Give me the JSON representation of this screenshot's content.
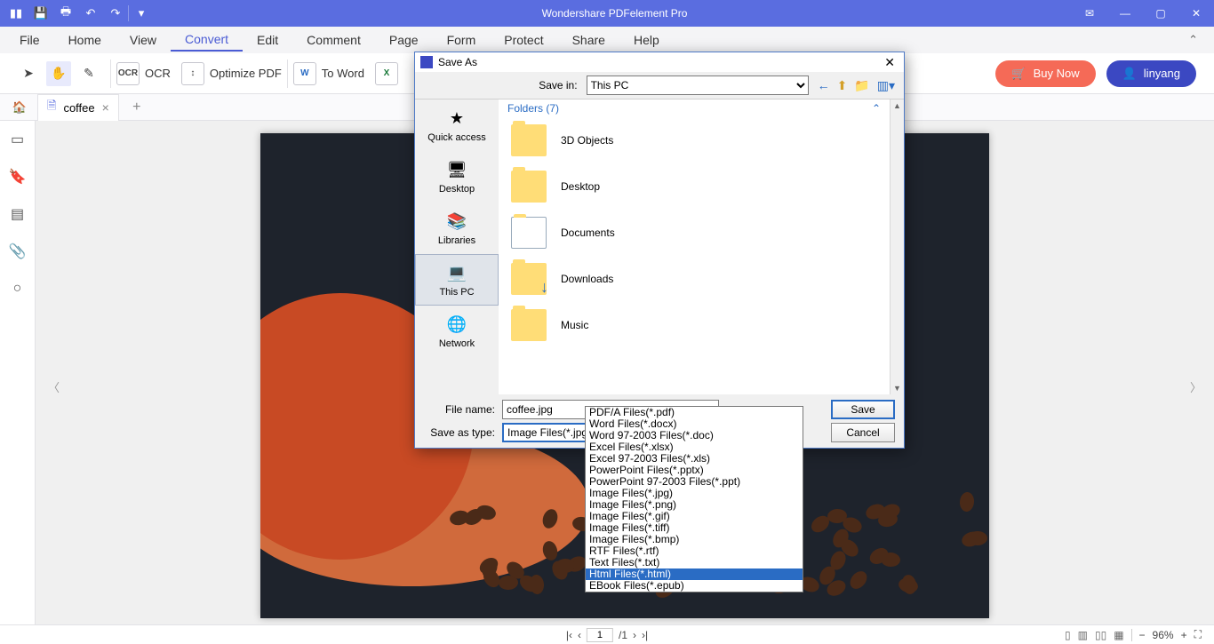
{
  "app": {
    "title": "Wondershare PDFelement Pro"
  },
  "menu": {
    "items": [
      "File",
      "Home",
      "View",
      "Convert",
      "Edit",
      "Comment",
      "Page",
      "Form",
      "Protect",
      "Share",
      "Help"
    ],
    "active": "Convert"
  },
  "ribbon": {
    "ocr": "OCR",
    "optimize": "Optimize PDF",
    "toword": "To Word",
    "buy": "Buy Now",
    "user": "linyang"
  },
  "tab": {
    "name": "coffee"
  },
  "dialog": {
    "title": "Save As",
    "savein_label": "Save in:",
    "savein_value": "This PC",
    "folders_header": "Folders (7)",
    "places": [
      "Quick access",
      "Desktop",
      "Libraries",
      "This PC",
      "Network"
    ],
    "folders": [
      "3D Objects",
      "Desktop",
      "Documents",
      "Downloads",
      "Music"
    ],
    "filename_label": "File name:",
    "filename_value": "coffee.jpg",
    "type_label": "Save as type:",
    "type_value": "Image Files(*.jpg)",
    "save": "Save",
    "cancel": "Cancel"
  },
  "types": [
    "PDF/A Files(*.pdf)",
    "Word Files(*.docx)",
    "Word 97-2003 Files(*.doc)",
    "Excel Files(*.xlsx)",
    "Excel 97-2003 Files(*.xls)",
    "PowerPoint Files(*.pptx)",
    "PowerPoint 97-2003 Files(*.ppt)",
    "Image Files(*.jpg)",
    "Image Files(*.png)",
    "Image Files(*.gif)",
    "Image Files(*.tiff)",
    "Image Files(*.bmp)",
    "RTF Files(*.rtf)",
    "Text Files(*.txt)",
    "Html Files(*.html)",
    "EBook Files(*.epub)"
  ],
  "types_selected": "Html Files(*.html)",
  "status": {
    "page": "1",
    "pages": "/1",
    "zoom": "96%"
  }
}
